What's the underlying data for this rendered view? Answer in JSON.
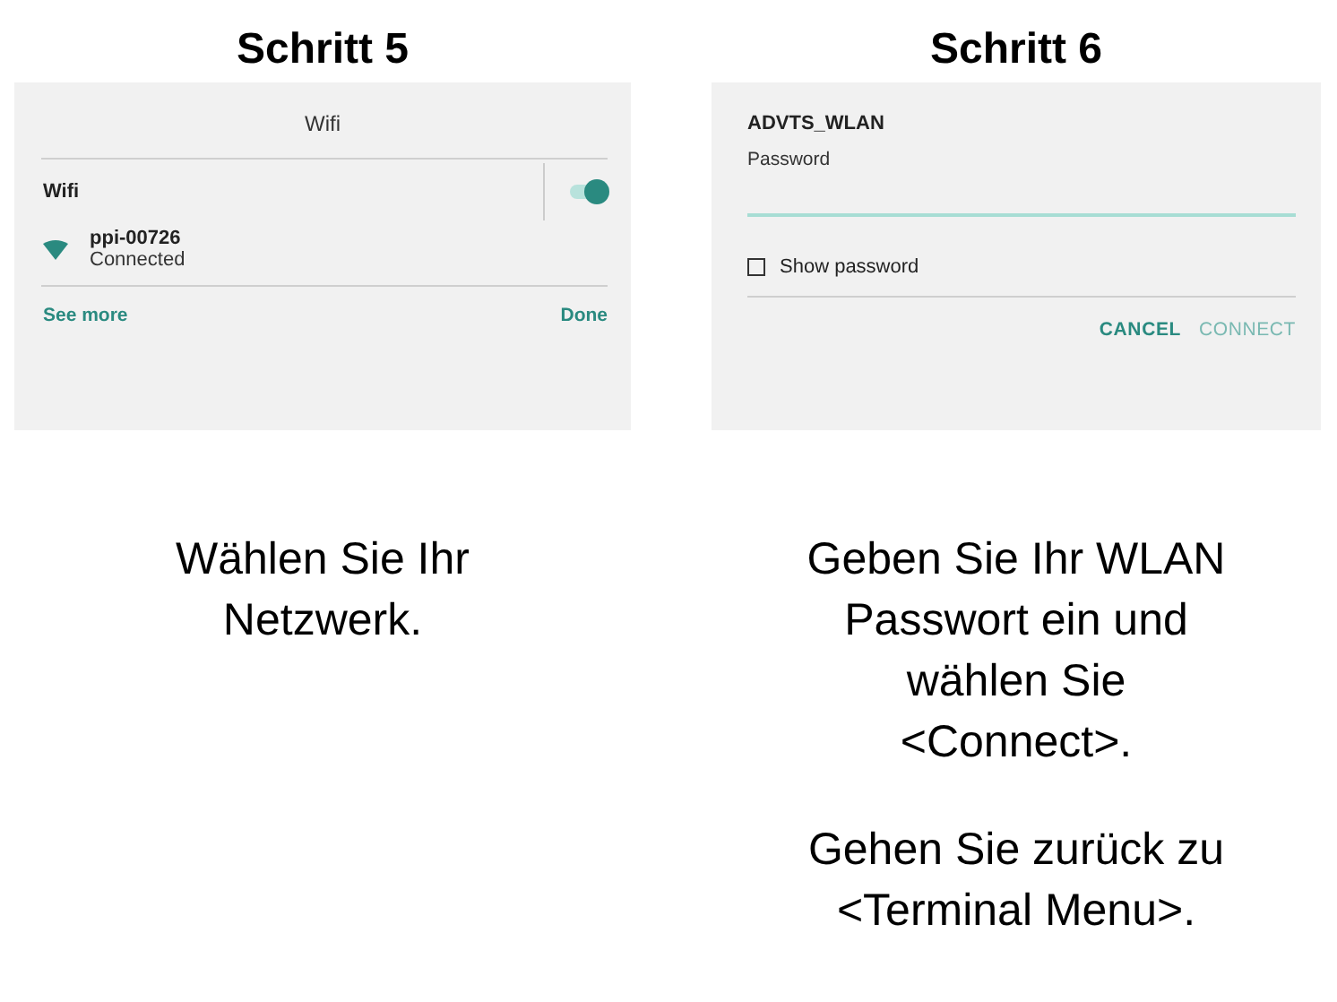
{
  "steps": [
    {
      "kind": "wifi",
      "heading": "Schritt 5",
      "screen": {
        "title": "Wifi",
        "toggle_label": "Wifi",
        "toggle_on": true,
        "network": {
          "name": "ppi-00726",
          "status": "Connected"
        },
        "actions": [
          {
            "label": "See more",
            "disabled": false
          },
          {
            "label": "Done",
            "disabled": false
          }
        ]
      },
      "captions": [
        "Wählen Sie Ihr\nNetzwerk."
      ]
    },
    {
      "kind": "password",
      "heading": "Schritt 6",
      "screen": {
        "title": "ADVTS_WLAN",
        "field_label": "Password",
        "show_password": {
          "label": "Show password",
          "checked": false
        },
        "actions": [
          {
            "label": "CANCEL",
            "disabled": false
          },
          {
            "label": "CONNECT",
            "disabled": true
          }
        ]
      },
      "captions": [
        "Geben Sie Ihr WLAN\nPasswort ein und\nwählen Sie\n<Connect>.",
        "Gehen Sie zurück zu\n<Terminal Menu>."
      ]
    }
  ]
}
